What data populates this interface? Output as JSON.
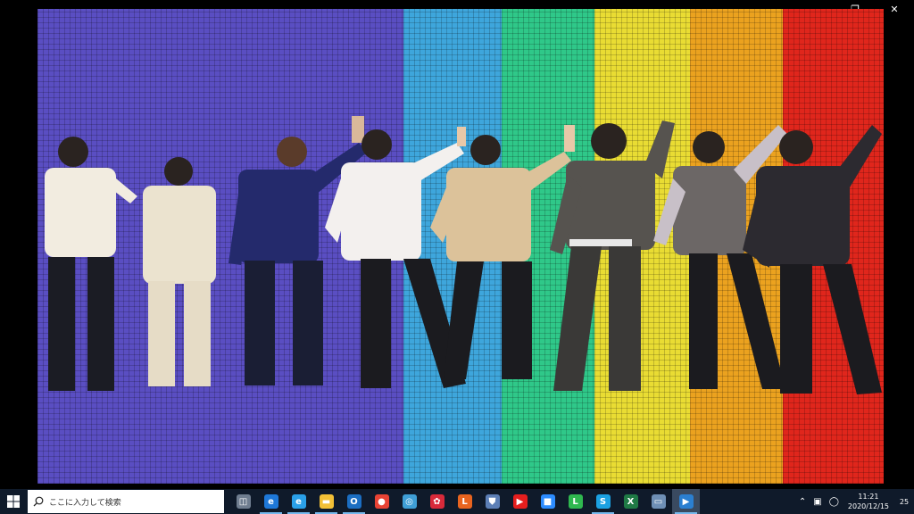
{
  "window": {
    "controls": {
      "minimize_icon": "minimize-icon",
      "restore_icon": "restore-icon",
      "close_icon": "close-icon"
    }
  },
  "video": {
    "bands": [
      {
        "name": "violet",
        "color": "#5a4ec2"
      },
      {
        "name": "blue",
        "color": "#3ea6dc"
      },
      {
        "name": "green",
        "color": "#2fc889"
      },
      {
        "name": "yellow",
        "color": "#e9dc33"
      },
      {
        "name": "orange",
        "color": "#eba21f"
      },
      {
        "name": "red",
        "color": "#e0261c"
      }
    ],
    "people_count": 8
  },
  "taskbar": {
    "search_placeholder": "ここに入力して検索",
    "apps": [
      {
        "name": "task-view",
        "color": "#6f7d8f",
        "glyph": "◫"
      },
      {
        "name": "edge",
        "color": "#1e78d8",
        "glyph": "e"
      },
      {
        "name": "internet-explorer",
        "color": "#2aa0e8",
        "glyph": "e"
      },
      {
        "name": "file-explorer",
        "color": "#f2c036",
        "glyph": "▬"
      },
      {
        "name": "outlook",
        "color": "#1b6ec2",
        "glyph": "O"
      },
      {
        "name": "chrome",
        "color": "#e84334",
        "glyph": "●"
      },
      {
        "name": "network-app",
        "color": "#3f9fd6",
        "glyph": "◎"
      },
      {
        "name": "red-app",
        "color": "#d82a3a",
        "glyph": "✿"
      },
      {
        "name": "l-app",
        "color": "#e8641f",
        "glyph": "L"
      },
      {
        "name": "shield-app",
        "color": "#5c7fb6",
        "glyph": "⛊"
      },
      {
        "name": "youtube",
        "color": "#e51e1e",
        "glyph": "▶"
      },
      {
        "name": "zoom",
        "color": "#2d8cff",
        "glyph": "■"
      },
      {
        "name": "line",
        "color": "#2fb84f",
        "glyph": "L"
      },
      {
        "name": "skype",
        "color": "#1ba1e2",
        "glyph": "S"
      },
      {
        "name": "excel",
        "color": "#1f7a45",
        "glyph": "X"
      },
      {
        "name": "window-app",
        "color": "#6e8fb5",
        "glyph": "▭"
      },
      {
        "name": "media-player",
        "color": "#2b7fd0",
        "glyph": "▶"
      }
    ],
    "clock_time": "11:21",
    "clock_date": "2020/12/15",
    "notification_count": "25"
  }
}
